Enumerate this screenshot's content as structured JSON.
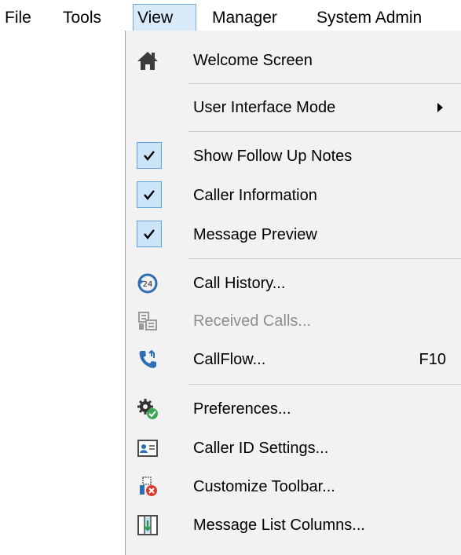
{
  "menubar": {
    "items": [
      "File",
      "Tools",
      "View",
      "Manager",
      "System Admin"
    ]
  },
  "view_menu": {
    "items": [
      {
        "label": "Welcome Screen",
        "icon": "home-icon"
      },
      {
        "label": "User Interface Mode",
        "submenu": true
      },
      {
        "label": "Show Follow Up Notes",
        "checked": true
      },
      {
        "label": "Caller Information",
        "checked": true
      },
      {
        "label": "Message Preview",
        "checked": true
      },
      {
        "label": "Call History...",
        "icon": "call-history-24-icon"
      },
      {
        "label": "Received Calls...",
        "icon": "received-calls-icon",
        "disabled": true
      },
      {
        "label": "CallFlow...",
        "icon": "callflow-phone-icon",
        "shortcut": "F10"
      },
      {
        "label": "Preferences...",
        "icon": "gear-check-icon"
      },
      {
        "label": "Caller ID Settings...",
        "icon": "id-card-icon"
      },
      {
        "label": "Customize Toolbar...",
        "icon": "customize-toolbar-icon"
      },
      {
        "label": "Message List Columns...",
        "icon": "columns-icon"
      }
    ]
  },
  "colors": {
    "menu_background": "#f2f2f2",
    "active_menu_highlight": "#d9ebf9",
    "check_box_fill": "#cce4f7",
    "check_box_border": "#5fa2dd",
    "disabled_text": "#8d8d8d"
  }
}
